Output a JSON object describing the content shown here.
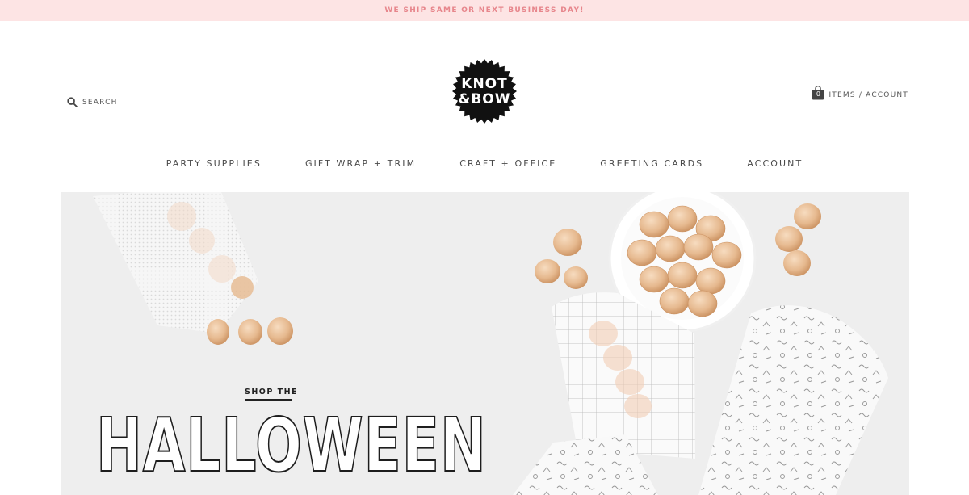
{
  "announcement": "WE SHIP SAME OR NEXT BUSINESS DAY!",
  "header": {
    "search_label": "SEARCH",
    "logo_line1": "KNOT",
    "logo_line2": "&BOW",
    "cart_count": "0",
    "account_text": "ITEMS / ACCOUNT"
  },
  "nav": {
    "items": [
      {
        "label": "PARTY SUPPLIES"
      },
      {
        "label": "GIFT WRAP + TRIM"
      },
      {
        "label": "CRAFT + OFFICE"
      },
      {
        "label": "GREETING CARDS"
      },
      {
        "label": "ACCOUNT"
      }
    ]
  },
  "hero": {
    "eyebrow": "SHOP THE",
    "title": "HALLOWEEN"
  },
  "colors": {
    "announcement_bg": "#fde4e4",
    "announcement_text": "#e7868c",
    "hero_bg": "#eeeeee",
    "candy_gold": "#e6b98f"
  },
  "icons": {
    "search": "search-icon",
    "bag": "shopping-bag-icon"
  }
}
